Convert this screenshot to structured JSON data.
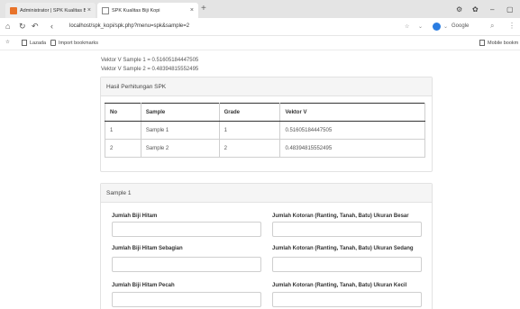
{
  "browser": {
    "tabs": [
      {
        "title": "Administrator | SPK Kualitas B",
        "active": false
      },
      {
        "title": "SPK Kualitas Biji Kopi",
        "active": true
      }
    ],
    "url": "localhost/spk_kopi/spk.php?menu=spk&sample=2",
    "search_engine": "Google",
    "bookmarks": [
      {
        "label": "Lazada"
      },
      {
        "label": "Import bookmarks"
      },
      {
        "label": "Mobile bookm"
      }
    ]
  },
  "page": {
    "vector_lines": [
      "Vektor V Sample 1 = 0.51605184447505",
      "Vektor V Sample 2 = 0.48394815552495"
    ],
    "result_panel": {
      "title": "Hasil Perhitungan SPK",
      "columns": [
        "No",
        "Sample",
        "Grade",
        "Vektor V"
      ],
      "rows": [
        [
          "1",
          "Sample 1",
          "1",
          "0.51605184447505"
        ],
        [
          "2",
          "Sample 2",
          "2",
          "0.48394815552495"
        ]
      ]
    },
    "sample_panel": {
      "title": "Sample 1",
      "fields": [
        {
          "label": "Jumlah Biji Hitam",
          "value": ""
        },
        {
          "label": "Jumlah Kotoran (Ranting, Tanah, Batu) Ukuran Besar",
          "value": ""
        },
        {
          "label": "Jumlah Biji Hitam Sebagian",
          "value": ""
        },
        {
          "label": "Jumlah Kotoran (Ranting, Tanah, Batu) Ukuran Sedang",
          "value": ""
        },
        {
          "label": "Jumlah Biji Hitam Pecah",
          "value": ""
        },
        {
          "label": "Jumlah Kotoran (Ranting, Tanah, Batu) Ukuran Kecil",
          "value": ""
        }
      ]
    }
  },
  "colors": {
    "tab_icon_active": "#e8732a",
    "engine": "#2a7de1"
  }
}
